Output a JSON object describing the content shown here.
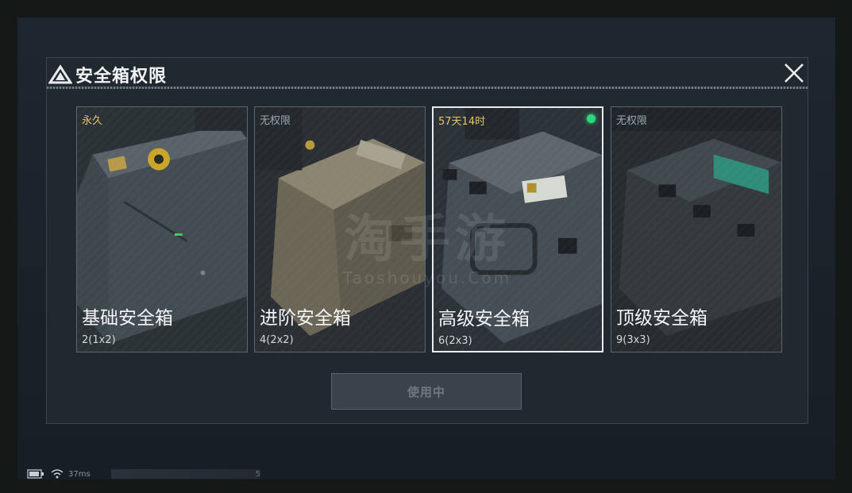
{
  "header": {
    "title": "安全箱权限"
  },
  "cards": [
    {
      "status": "永久",
      "name": "基础安全箱",
      "size": "2(1x2)",
      "status_color": "gold",
      "selected": false,
      "active": false
    },
    {
      "status": "无权限",
      "name": "进阶安全箱",
      "size": "4(2x2)",
      "status_color": "gray",
      "selected": false,
      "active": false
    },
    {
      "status": "57天14时",
      "name": "高级安全箱",
      "size": "6(2x3)",
      "status_color": "gold",
      "selected": true,
      "active": true
    },
    {
      "status": "无权限",
      "name": "顶级安全箱",
      "size": "9(3x3)",
      "status_color": "gray",
      "selected": false,
      "active": false
    }
  ],
  "use_button": {
    "label": "使用中"
  },
  "watermark": {
    "main": "淘手游",
    "sub": "Taoshouyou.Com"
  },
  "statusbar": {
    "ping": "37ms",
    "tail": "5"
  },
  "colors": {
    "accent_gold": "#e6c46a",
    "active_dot": "#2fd67e"
  }
}
